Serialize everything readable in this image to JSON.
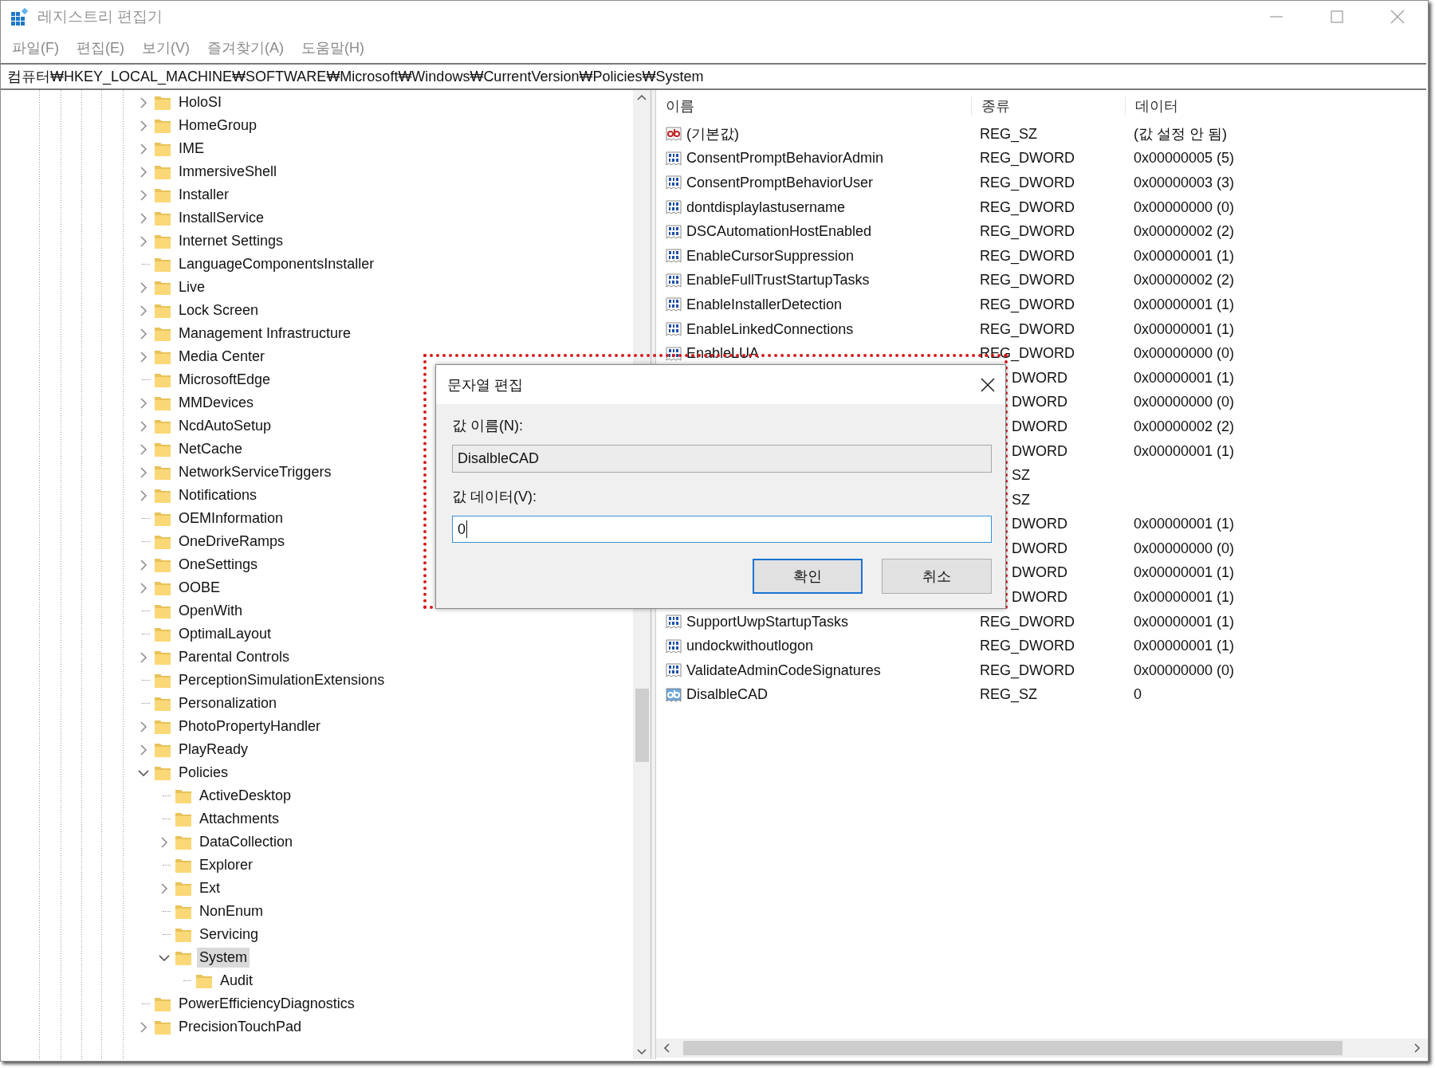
{
  "window": {
    "title": "레지스트리 편집기"
  },
  "menu": [
    "파일(F)",
    "편집(E)",
    "보기(V)",
    "즐겨찾기(A)",
    "도움말(H)"
  ],
  "address": "컴퓨터₩HKEY_LOCAL_MACHINE₩SOFTWARE₩Microsoft₩Windows₩CurrentVersion₩Policies₩System",
  "tree": [
    {
      "label": "HoloSI",
      "expandable": true,
      "expanded": false,
      "selected": false
    },
    {
      "label": "HomeGroup",
      "expandable": true,
      "expanded": false,
      "selected": false
    },
    {
      "label": "IME",
      "expandable": true,
      "expanded": false,
      "selected": false
    },
    {
      "label": "ImmersiveShell",
      "expandable": true,
      "expanded": false,
      "selected": false
    },
    {
      "label": "Installer",
      "expandable": true,
      "expanded": false,
      "selected": false
    },
    {
      "label": "InstallService",
      "expandable": true,
      "expanded": false,
      "selected": false
    },
    {
      "label": "Internet Settings",
      "expandable": true,
      "expanded": false,
      "selected": false
    },
    {
      "label": "LanguageComponentsInstaller",
      "expandable": false,
      "expanded": false,
      "selected": false
    },
    {
      "label": "Live",
      "expandable": true,
      "expanded": false,
      "selected": false
    },
    {
      "label": "Lock Screen",
      "expandable": true,
      "expanded": false,
      "selected": false
    },
    {
      "label": "Management Infrastructure",
      "expandable": true,
      "expanded": false,
      "selected": false
    },
    {
      "label": "Media Center",
      "expandable": true,
      "expanded": false,
      "selected": false
    },
    {
      "label": "MicrosoftEdge",
      "expandable": false,
      "expanded": false,
      "selected": false
    },
    {
      "label": "MMDevices",
      "expandable": true,
      "expanded": false,
      "selected": false
    },
    {
      "label": "NcdAutoSetup",
      "expandable": true,
      "expanded": false,
      "selected": false
    },
    {
      "label": "NetCache",
      "expandable": true,
      "expanded": false,
      "selected": false
    },
    {
      "label": "NetworkServiceTriggers",
      "expandable": true,
      "expanded": false,
      "selected": false
    },
    {
      "label": "Notifications",
      "expandable": true,
      "expanded": false,
      "selected": false
    },
    {
      "label": "OEMInformation",
      "expandable": false,
      "expanded": false,
      "selected": false
    },
    {
      "label": "OneDriveRamps",
      "expandable": false,
      "expanded": false,
      "selected": false
    },
    {
      "label": "OneSettings",
      "expandable": true,
      "expanded": false,
      "selected": false
    },
    {
      "label": "OOBE",
      "expandable": true,
      "expanded": false,
      "selected": false
    },
    {
      "label": "OpenWith",
      "expandable": false,
      "expanded": false,
      "selected": false
    },
    {
      "label": "OptimalLayout",
      "expandable": false,
      "expanded": false,
      "selected": false
    },
    {
      "label": "Parental Controls",
      "expandable": true,
      "expanded": false,
      "selected": false
    },
    {
      "label": "PerceptionSimulationExtensions",
      "expandable": false,
      "expanded": false,
      "selected": false
    },
    {
      "label": "Personalization",
      "expandable": false,
      "expanded": false,
      "selected": false
    },
    {
      "label": "PhotoPropertyHandler",
      "expandable": true,
      "expanded": false,
      "selected": false
    },
    {
      "label": "PlayReady",
      "expandable": true,
      "expanded": false,
      "selected": false
    },
    {
      "label": "Policies",
      "expandable": true,
      "expanded": true,
      "selected": false,
      "children": [
        {
          "label": "ActiveDesktop",
          "expandable": false,
          "expanded": false,
          "selected": false
        },
        {
          "label": "Attachments",
          "expandable": false,
          "expanded": false,
          "selected": false
        },
        {
          "label": "DataCollection",
          "expandable": true,
          "expanded": false,
          "selected": false
        },
        {
          "label": "Explorer",
          "expandable": false,
          "expanded": false,
          "selected": false
        },
        {
          "label": "Ext",
          "expandable": true,
          "expanded": false,
          "selected": false
        },
        {
          "label": "NonEnum",
          "expandable": false,
          "expanded": false,
          "selected": false
        },
        {
          "label": "Servicing",
          "expandable": false,
          "expanded": false,
          "selected": false
        },
        {
          "label": "System",
          "expandable": true,
          "expanded": true,
          "selected": true,
          "children": [
            {
              "label": "Audit",
              "expandable": false,
              "expanded": false,
              "selected": false
            }
          ]
        }
      ]
    },
    {
      "label": "PowerEfficiencyDiagnostics",
      "expandable": false,
      "expanded": false,
      "selected": false
    },
    {
      "label": "PrecisionTouchPad",
      "expandable": true,
      "expanded": false,
      "selected": false
    }
  ],
  "list": {
    "columns": [
      "이름",
      "종류",
      "데이터"
    ],
    "rows": [
      {
        "kind": "sz",
        "name": "(기본값)",
        "type": "REG_SZ",
        "data": "(값 설정 안 됨)",
        "selected": false
      },
      {
        "kind": "dword",
        "name": "ConsentPromptBehaviorAdmin",
        "type": "REG_DWORD",
        "data": "0x00000005 (5)",
        "selected": false
      },
      {
        "kind": "dword",
        "name": "ConsentPromptBehaviorUser",
        "type": "REG_DWORD",
        "data": "0x00000003 (3)",
        "selected": false
      },
      {
        "kind": "dword",
        "name": "dontdisplaylastusername",
        "type": "REG_DWORD",
        "data": "0x00000000 (0)",
        "selected": false
      },
      {
        "kind": "dword",
        "name": "DSCAutomationHostEnabled",
        "type": "REG_DWORD",
        "data": "0x00000002 (2)",
        "selected": false
      },
      {
        "kind": "dword",
        "name": "EnableCursorSuppression",
        "type": "REG_DWORD",
        "data": "0x00000001 (1)",
        "selected": false
      },
      {
        "kind": "dword",
        "name": "EnableFullTrustStartupTasks",
        "type": "REG_DWORD",
        "data": "0x00000002 (2)",
        "selected": false
      },
      {
        "kind": "dword",
        "name": "EnableInstallerDetection",
        "type": "REG_DWORD",
        "data": "0x00000001 (1)",
        "selected": false
      },
      {
        "kind": "dword",
        "name": "EnableLinkedConnections",
        "type": "REG_DWORD",
        "data": "0x00000001 (1)",
        "selected": false
      },
      {
        "kind": "dword",
        "name": "EnableLUA",
        "type": "REG_DWORD",
        "data": "0x00000000 (0)",
        "selected": false
      },
      {
        "kind": "covered",
        "type": "DWORD",
        "data": "0x00000001 (1)",
        "selected": false
      },
      {
        "kind": "covered",
        "type": "DWORD",
        "data": "0x00000000 (0)",
        "selected": false
      },
      {
        "kind": "covered",
        "type": "DWORD",
        "data": "0x00000002 (2)",
        "selected": false
      },
      {
        "kind": "covered",
        "type": "DWORD",
        "data": "0x00000001 (1)",
        "selected": false
      },
      {
        "kind": "covered",
        "type": "SZ",
        "selected": false
      },
      {
        "kind": "covered",
        "type": "SZ",
        "selected": false
      },
      {
        "kind": "covered",
        "type": "DWORD",
        "data": "0x00000001 (1)",
        "selected": false
      },
      {
        "kind": "covered",
        "type": "DWORD",
        "data": "0x00000000 (0)",
        "selected": false
      },
      {
        "kind": "covered",
        "type": "DWORD",
        "data": "0x00000001 (1)",
        "selected": false
      },
      {
        "kind": "covered",
        "type": "DWORD",
        "data": "0x00000001 (1)",
        "selected": false
      },
      {
        "kind": "dword",
        "name": "SupportUwpStartupTasks",
        "type": "REG_DWORD",
        "data": "0x00000001 (1)",
        "selected": false
      },
      {
        "kind": "dword",
        "name": "undockwithoutlogon",
        "type": "REG_DWORD",
        "data": "0x00000001 (1)",
        "selected": false
      },
      {
        "kind": "dword",
        "name": "ValidateAdminCodeSignatures",
        "type": "REG_DWORD",
        "data": "0x00000000 (0)",
        "selected": false
      },
      {
        "kind": "sz",
        "name": "DisalbleCAD",
        "type": "REG_SZ",
        "data": "0",
        "selected": true
      }
    ]
  },
  "dialog": {
    "title": "문자열 편집",
    "name_label": "값 이름(N):",
    "name_value": "DisalbleCAD",
    "data_label": "값 데이터(V):",
    "data_value": "0",
    "buttons": [
      {
        "label": "확인",
        "default": true
      },
      {
        "label": "취소",
        "default": false
      }
    ]
  }
}
